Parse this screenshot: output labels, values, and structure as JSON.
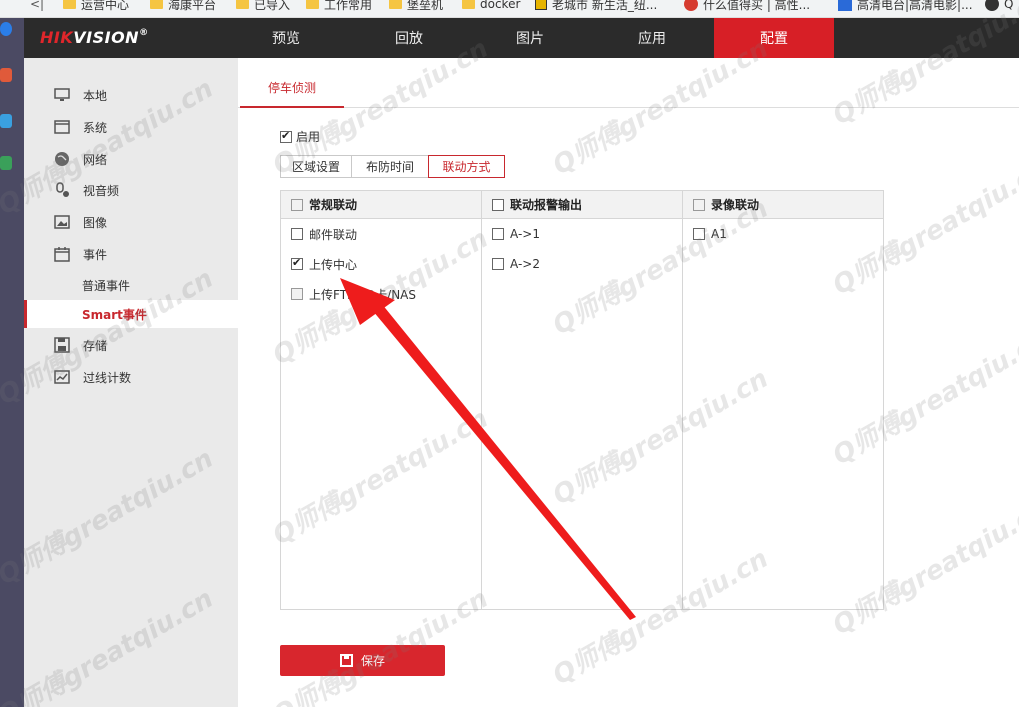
{
  "bookmarks": [
    {
      "label": "运营中心",
      "icon": "folder-icon"
    },
    {
      "label": "海康平台",
      "icon": "folder-icon"
    },
    {
      "label": "已导入",
      "icon": "folder-icon"
    },
    {
      "label": "工作常用",
      "icon": "folder-icon"
    },
    {
      "label": "堡垒机",
      "icon": "folder-icon"
    },
    {
      "label": "docker",
      "icon": "folder-icon"
    },
    {
      "label": "老城市 新生活_纽...",
      "icon": "site-favicon"
    },
    {
      "label": "什么值得买 | 高性...",
      "icon": "site-favicon"
    },
    {
      "label": "高清电台|高清电影|...",
      "icon": "site-favicon"
    },
    {
      "label": "Q",
      "icon": "site-favicon"
    }
  ],
  "header": {
    "logo_brand": "HIK",
    "logo_rest": "VISION",
    "logo_reg": "®",
    "tabs": [
      {
        "label": "预览",
        "active": false
      },
      {
        "label": "回放",
        "active": false
      },
      {
        "label": "图片",
        "active": false
      },
      {
        "label": "应用",
        "active": false
      },
      {
        "label": "配置",
        "active": true
      }
    ]
  },
  "sidebar": {
    "items": [
      {
        "label": "本地",
        "icon": "monitor-icon"
      },
      {
        "label": "系统",
        "icon": "system-icon"
      },
      {
        "label": "网络",
        "icon": "globe-icon"
      },
      {
        "label": "视音频",
        "icon": "mic-camera-icon"
      },
      {
        "label": "图像",
        "icon": "image-icon"
      },
      {
        "label": "事件",
        "icon": "calendar-icon"
      }
    ],
    "sub_items": [
      {
        "label": "普通事件",
        "active": false
      },
      {
        "label": "Smart事件",
        "active": true
      }
    ],
    "items_after": [
      {
        "label": "存储",
        "icon": "save-disk-icon"
      },
      {
        "label": "过线计数",
        "icon": "chart-icon"
      }
    ]
  },
  "main": {
    "page_tab": "停车侦测",
    "enable_label": "启用",
    "enable_checked": true,
    "subtabs": [
      {
        "label": "区域设置",
        "active": false
      },
      {
        "label": "布防时间",
        "active": false
      },
      {
        "label": "联动方式",
        "active": true
      }
    ],
    "columns": [
      {
        "header": "常规联动",
        "header_checked": false,
        "rows": [
          {
            "label": "邮件联动",
            "checked": false
          },
          {
            "label": "上传中心",
            "checked": true
          },
          {
            "label": "上传FTP/SD卡/NAS",
            "checked": false
          }
        ]
      },
      {
        "header": "联动报警输出",
        "header_checked": false,
        "rows": [
          {
            "label": "A->1",
            "checked": false
          },
          {
            "label": "A->2",
            "checked": false
          }
        ]
      },
      {
        "header": "录像联动",
        "header_checked": false,
        "rows": [
          {
            "label": "A1",
            "checked": false
          }
        ]
      }
    ],
    "save_label": "保存"
  },
  "watermark_text": "Q师傅greatqiu.cn",
  "colors": {
    "accent": "#d71f26",
    "nav_bg": "#2b2b2b",
    "sidebar_bg": "#eaeaea",
    "annotation_arrow": "#ee1c1c"
  }
}
